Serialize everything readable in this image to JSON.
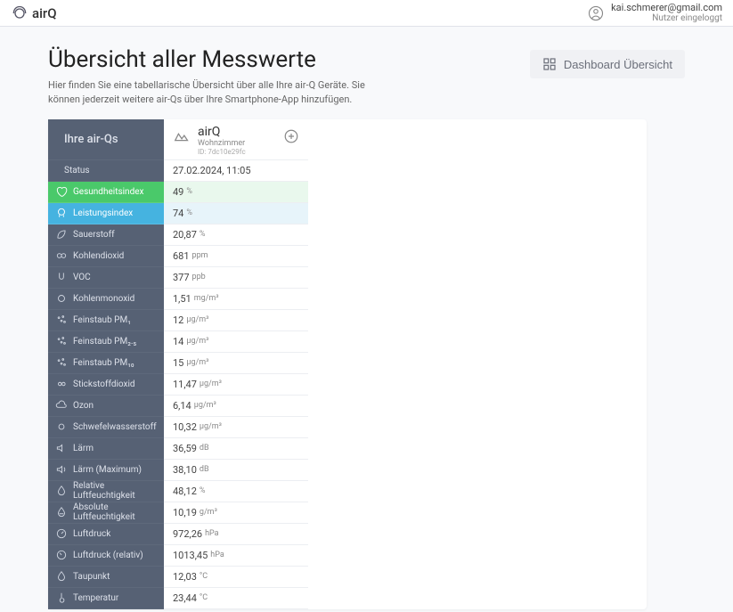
{
  "brand": {
    "name": "airQ"
  },
  "user": {
    "email": "kai.schmerer@gmail.com",
    "status": "Nutzer eingeloggt"
  },
  "page": {
    "title": "Übersicht aller Messwerte",
    "subtitle": "Hier finden Sie eine tabellarische Übersicht über alle Ihre air-Q Geräte. Sie können jederzeit weitere air-Qs über Ihre Smartphone-App hinzufügen.",
    "dashboard_btn": "Dashboard Übersicht"
  },
  "left_header": "Ihre air-Qs",
  "device": {
    "name": "airQ",
    "room": "Wohnzimmer",
    "id_label": "ID: 7dc10e29fc"
  },
  "rows": {
    "status": {
      "label": "Status",
      "value": "27.02.2024, 11:05",
      "unit": ""
    },
    "health": {
      "label": "Gesundheitsindex",
      "value": "49",
      "unit": "%"
    },
    "perf": {
      "label": "Leistungsindex",
      "value": "74",
      "unit": "%"
    },
    "o2": {
      "label": "Sauerstoff",
      "value": "20,87",
      "unit": "%"
    },
    "co2": {
      "label": "Kohlendioxid",
      "value": "681",
      "unit": "ppm"
    },
    "voc": {
      "label": "VOC",
      "value": "377",
      "unit": "ppb"
    },
    "co": {
      "label": "Kohlenmonoxid",
      "value": "1,51",
      "unit": "mg/m³"
    },
    "pm1": {
      "label": "Feinstaub PM₁",
      "value": "12",
      "unit": "μg/m³"
    },
    "pm25": {
      "label": "Feinstaub PM₂.₅",
      "value": "14",
      "unit": "μg/m³"
    },
    "pm10": {
      "label": "Feinstaub PM₁₀",
      "value": "15",
      "unit": "μg/m³"
    },
    "no2": {
      "label": "Stickstoffdioxid",
      "value": "11,47",
      "unit": "μg/m³"
    },
    "o3": {
      "label": "Ozon",
      "value": "6,14",
      "unit": "μg/m³"
    },
    "h2s": {
      "label": "Schwefelwasserstoff",
      "value": "10,32",
      "unit": "μg/m³"
    },
    "noise": {
      "label": "Lärm",
      "value": "36,59",
      "unit": "dB"
    },
    "noisemax": {
      "label": "Lärm (Maximum)",
      "value": "38,10",
      "unit": "dB"
    },
    "relhum": {
      "label": "Relative Luftfeuchtigkeit",
      "value": "48,12",
      "unit": "%"
    },
    "abshum": {
      "label": "Absolute Luftfeuchtigkeit",
      "value": "10,19",
      "unit": "g/m³"
    },
    "press": {
      "label": "Luftdruck",
      "value": "972,26",
      "unit": "hPa"
    },
    "pressrel": {
      "label": "Luftdruck (relativ)",
      "value": "1013,45",
      "unit": "hPa"
    },
    "dew": {
      "label": "Taupunkt",
      "value": "12,03",
      "unit": "°C"
    },
    "temp": {
      "label": "Temperatur",
      "value": "23,44",
      "unit": "°C"
    }
  }
}
